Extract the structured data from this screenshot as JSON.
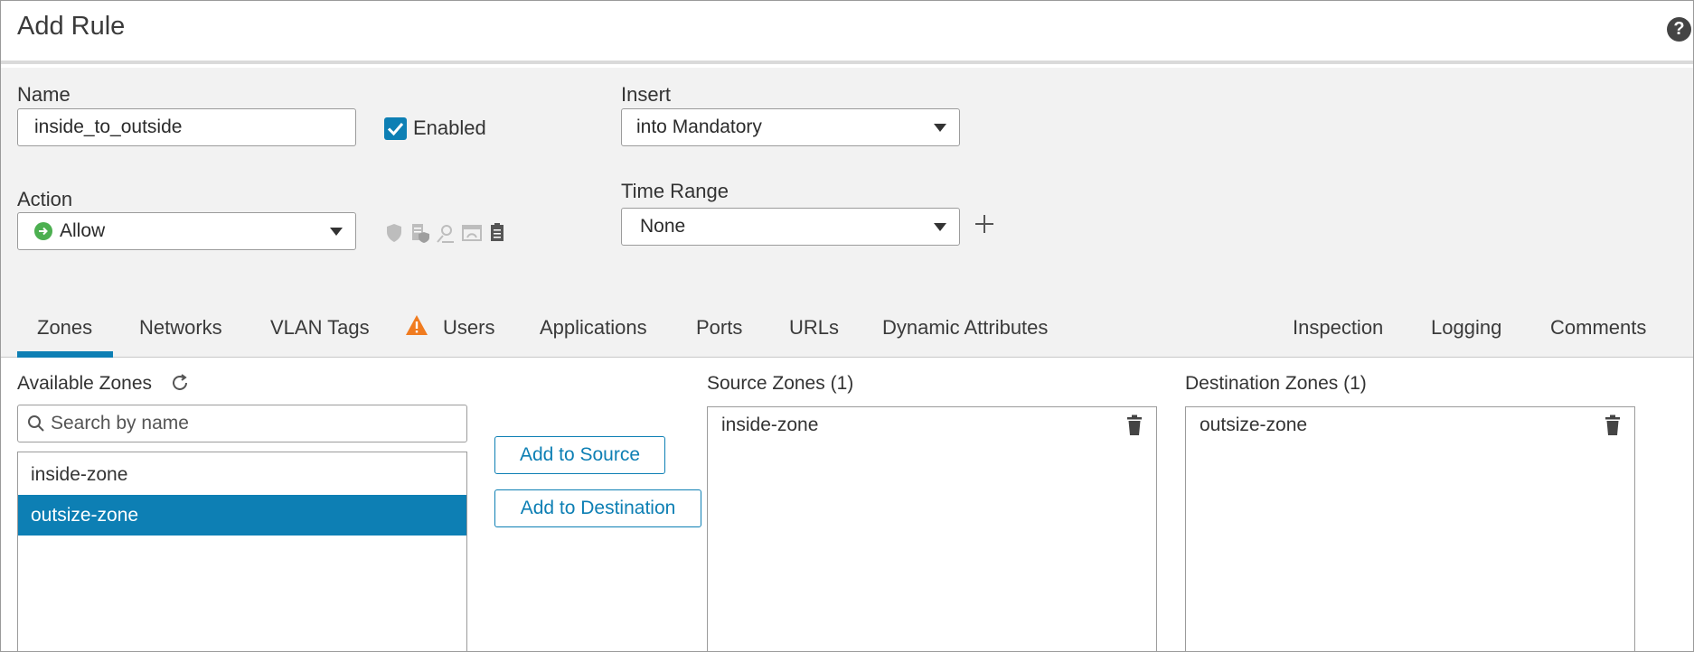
{
  "header": {
    "title": "Add Rule",
    "help_label": "?"
  },
  "form": {
    "name_label": "Name",
    "name_value": "inside_to_outside",
    "enabled_label": "Enabled",
    "insert_label": "Insert",
    "insert_value": "into Mandatory",
    "action_label": "Action",
    "action_value": "Allow",
    "time_range_label": "Time Range",
    "time_range_value": "None"
  },
  "tabs": [
    {
      "label": "Zones",
      "active": true
    },
    {
      "label": "Networks"
    },
    {
      "label": "VLAN Tags"
    },
    {
      "label": "Users",
      "warning": true
    },
    {
      "label": "Applications"
    },
    {
      "label": "Ports"
    },
    {
      "label": "URLs"
    },
    {
      "label": "Dynamic Attributes"
    },
    {
      "label": "Inspection"
    },
    {
      "label": "Logging"
    },
    {
      "label": "Comments"
    }
  ],
  "zones": {
    "available_label": "Available Zones",
    "search_placeholder": "Search by name",
    "available": [
      {
        "name": "inside-zone",
        "selected": false
      },
      {
        "name": "outsize-zone",
        "selected": true
      }
    ],
    "add_to_source": "Add to Source",
    "add_to_destination": "Add to Destination",
    "source_label": "Source Zones (1)",
    "source_items": [
      "inside-zone"
    ],
    "destination_label": "Destination Zones (1)",
    "destination_items": [
      "outsize-zone"
    ]
  },
  "colors": {
    "accent": "#0d7fb4",
    "warning": "#f07b1f",
    "allow": "#4caf50"
  }
}
